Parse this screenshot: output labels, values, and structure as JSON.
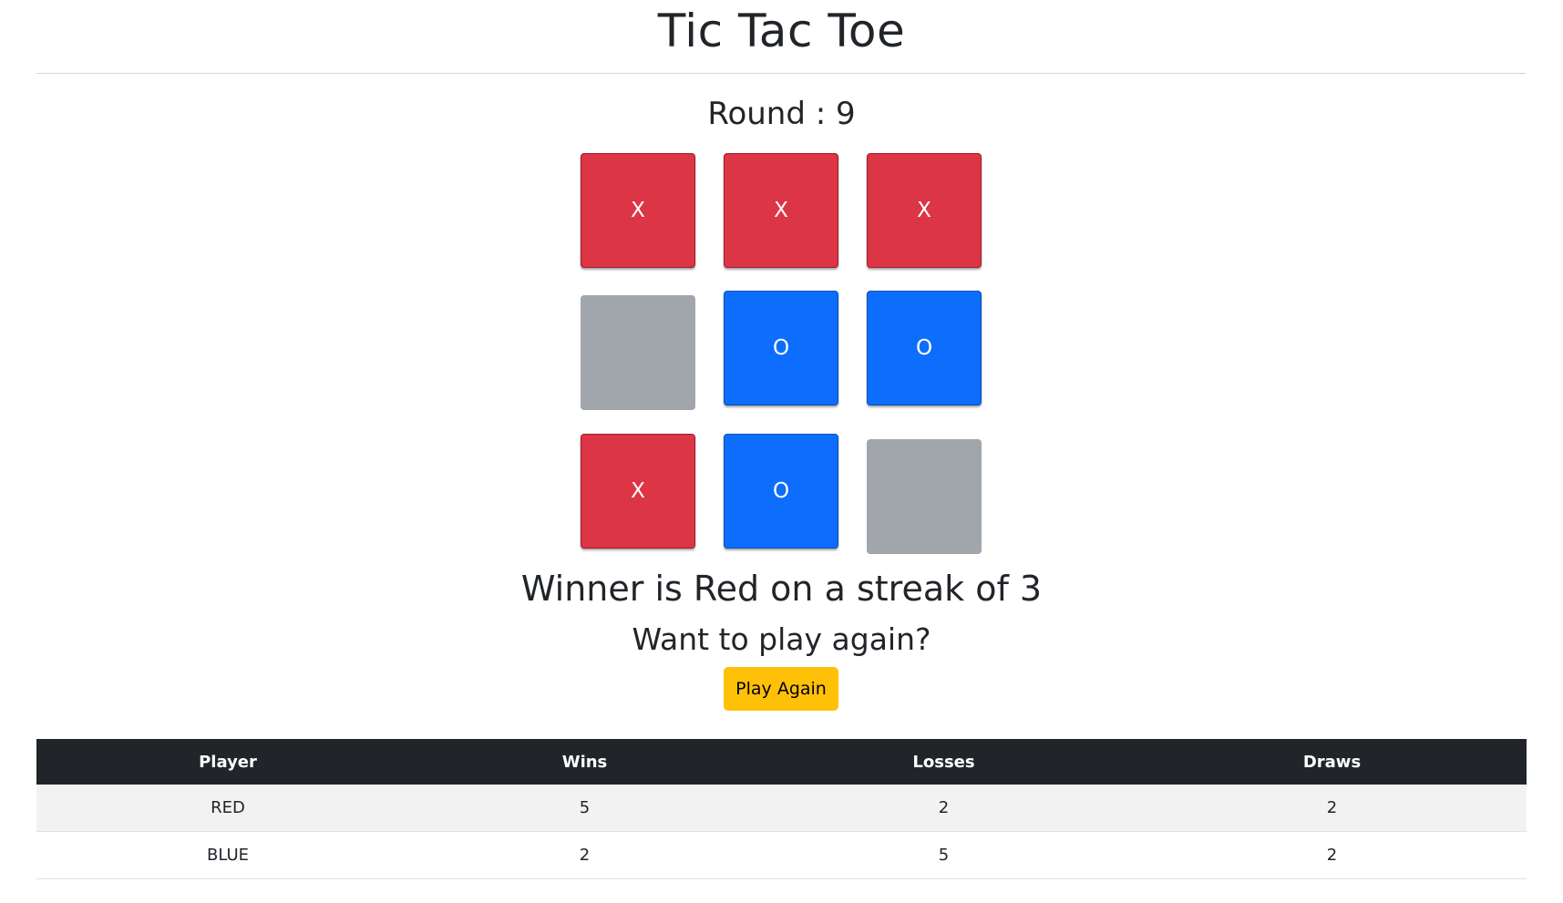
{
  "title": "Tic Tac Toe",
  "round": {
    "label": "Round : 9"
  },
  "board": {
    "cells": [
      {
        "mark": "X",
        "color": "red"
      },
      {
        "mark": "X",
        "color": "red"
      },
      {
        "mark": "X",
        "color": "red"
      },
      {
        "mark": "",
        "color": "empty"
      },
      {
        "mark": "O",
        "color": "blue"
      },
      {
        "mark": "O",
        "color": "blue"
      },
      {
        "mark": "X",
        "color": "red"
      },
      {
        "mark": "O",
        "color": "blue"
      },
      {
        "mark": "",
        "color": "empty"
      }
    ]
  },
  "result": {
    "winner_text": "Winner is Red on a streak of 3",
    "prompt": "Want to play again?",
    "button_label": "Play Again"
  },
  "scores": {
    "headers": [
      "Player",
      "Wins",
      "Losses",
      "Draws"
    ],
    "rows": [
      [
        "RED",
        "5",
        "2",
        "2"
      ],
      [
        "BLUE",
        "2",
        "5",
        "2"
      ]
    ]
  },
  "colors": {
    "red": "#dc3545",
    "blue": "#0d6efd",
    "empty": "#a1a6ac",
    "warning": "#ffc107",
    "table_header": "#212529"
  }
}
